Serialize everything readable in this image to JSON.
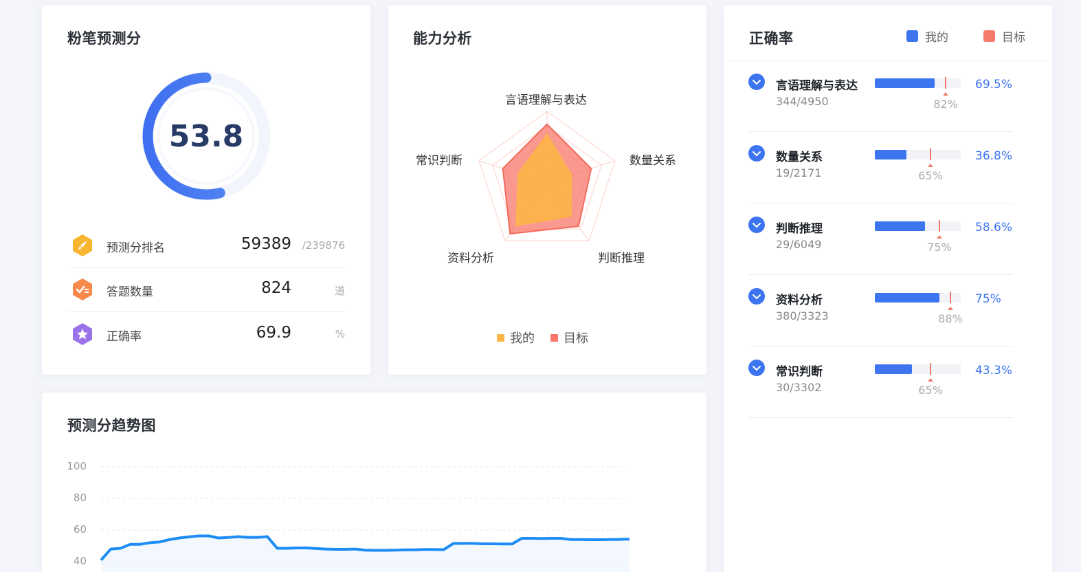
{
  "score_card": {
    "title": "粉笔预测分",
    "score": "53.8",
    "score_fraction": 0.538,
    "stats": [
      {
        "icon": "rocket-icon",
        "label": "预测分排名",
        "value": "59389",
        "unit": "/239876",
        "color": "#f8b530"
      },
      {
        "icon": "check-list-icon",
        "label": "答题数量",
        "value": "824",
        "unit": "道",
        "color": "#f7894a"
      },
      {
        "icon": "star-icon",
        "label": "正确率",
        "value": "69.9",
        "unit": "%",
        "color": "#9a73e8"
      }
    ]
  },
  "radar_card": {
    "title": "能力分析",
    "axes": [
      "言语理解与表达",
      "数量关系",
      "判断推理",
      "资料分析",
      "常识判断"
    ],
    "mine": [
      69.5,
      36.8,
      58.6,
      75,
      43.3
    ],
    "target": [
      82,
      65,
      75,
      88,
      65
    ],
    "legend": {
      "mine": "我的",
      "target": "目标"
    },
    "colors": {
      "mine": "#fcb547",
      "target": "#f8776a"
    }
  },
  "trend_card": {
    "title": "预测分趋势图",
    "y_ticks": [
      "100",
      "80",
      "60",
      "40"
    ]
  },
  "chart_data": {
    "type": "line",
    "title": "预测分趋势图",
    "ylim": [
      0,
      100
    ],
    "grid": true,
    "series": [
      {
        "values": [
          41,
          48,
          48.5,
          51,
          51,
          52,
          52.5,
          54,
          55,
          55.7,
          56.3,
          56.3,
          55,
          55.3,
          55.8,
          55.4,
          55.4,
          55.8,
          48.5,
          48.5,
          48.7,
          48.7,
          48.3,
          48,
          47.8,
          47.8,
          48,
          47.3,
          47.2,
          47.2,
          47.3,
          47.5,
          47.5,
          47.7,
          47.7,
          47.6,
          51.5,
          51.6,
          51.6,
          51.3,
          51.3,
          51.2,
          51.2,
          54.8,
          54.8,
          54.7,
          54.8,
          54.8,
          54,
          54,
          53.9,
          53.9,
          54,
          54.1,
          54.3
        ]
      }
    ]
  },
  "accuracy_card": {
    "title": "正确率",
    "legend": {
      "mine": "我的",
      "target": "目标"
    },
    "colors": {
      "mine": "#3d74f0",
      "target": "#f47a6c"
    },
    "items": [
      {
        "name": "言语理解与表达",
        "count": "344/4950",
        "pct": "69.5%",
        "mine": 0.695,
        "target": 0.82,
        "target_label": "82%"
      },
      {
        "name": "数量关系",
        "count": "19/2171",
        "pct": "36.8%",
        "mine": 0.368,
        "target": 0.65,
        "target_label": "65%"
      },
      {
        "name": "判断推理",
        "count": "29/6049",
        "pct": "58.6%",
        "mine": 0.586,
        "target": 0.75,
        "target_label": "75%"
      },
      {
        "name": "资料分析",
        "count": "380/3323",
        "pct": "75%",
        "mine": 0.75,
        "target": 0.88,
        "target_label": "88%"
      },
      {
        "name": "常识判断",
        "count": "30/3302",
        "pct": "43.3%",
        "mine": 0.433,
        "target": 0.65,
        "target_label": "65%"
      }
    ]
  }
}
